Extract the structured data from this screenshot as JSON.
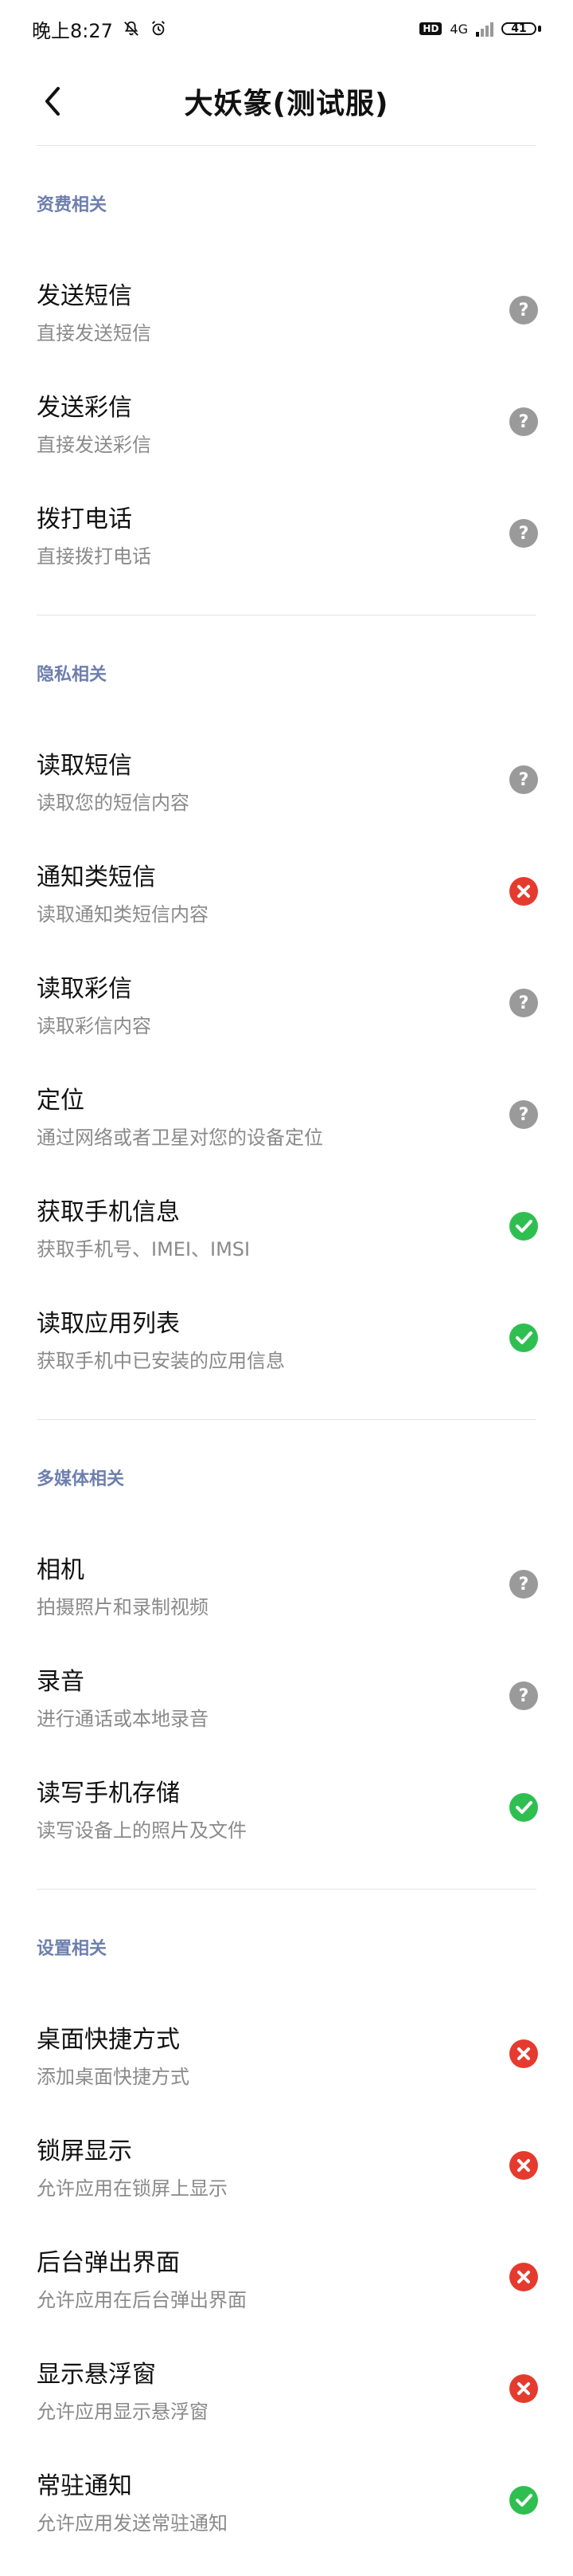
{
  "status_bar": {
    "time": "晚上8:27",
    "hd": "HD",
    "net": "4G",
    "battery": "41"
  },
  "header": {
    "title": "大妖篆(测试服)"
  },
  "colors": {
    "section_title": "#6e7fae",
    "unknown": "#9a9a9a",
    "denied": "#e53b2f",
    "granted": "#2fbf51"
  },
  "sections": [
    {
      "title": "资费相关",
      "items": [
        {
          "title": "发送短信",
          "desc": "直接发送短信",
          "status": "unknown"
        },
        {
          "title": "发送彩信",
          "desc": "直接发送彩信",
          "status": "unknown"
        },
        {
          "title": "拨打电话",
          "desc": "直接拨打电话",
          "status": "unknown"
        }
      ]
    },
    {
      "title": "隐私相关",
      "items": [
        {
          "title": "读取短信",
          "desc": "读取您的短信内容",
          "status": "unknown"
        },
        {
          "title": "通知类短信",
          "desc": "读取通知类短信内容",
          "status": "denied"
        },
        {
          "title": "读取彩信",
          "desc": "读取彩信内容",
          "status": "unknown"
        },
        {
          "title": "定位",
          "desc": "通过网络或者卫星对您的设备定位",
          "status": "unknown"
        },
        {
          "title": "获取手机信息",
          "desc": "获取手机号、IMEI、IMSI",
          "status": "granted"
        },
        {
          "title": "读取应用列表",
          "desc": "获取手机中已安装的应用信息",
          "status": "granted"
        }
      ]
    },
    {
      "title": "多媒体相关",
      "items": [
        {
          "title": "相机",
          "desc": "拍摄照片和录制视频",
          "status": "unknown"
        },
        {
          "title": "录音",
          "desc": "进行通话或本地录音",
          "status": "unknown"
        },
        {
          "title": "读写手机存储",
          "desc": "读写设备上的照片及文件",
          "status": "granted"
        }
      ]
    },
    {
      "title": "设置相关",
      "items": [
        {
          "title": "桌面快捷方式",
          "desc": "添加桌面快捷方式",
          "status": "denied"
        },
        {
          "title": "锁屏显示",
          "desc": "允许应用在锁屏上显示",
          "status": "denied"
        },
        {
          "title": "后台弹出界面",
          "desc": "允许应用在后台弹出界面",
          "status": "denied"
        },
        {
          "title": "显示悬浮窗",
          "desc": "允许应用显示悬浮窗",
          "status": "denied"
        },
        {
          "title": "常驻通知",
          "desc": "允许应用发送常驻通知",
          "status": "granted"
        }
      ]
    }
  ]
}
